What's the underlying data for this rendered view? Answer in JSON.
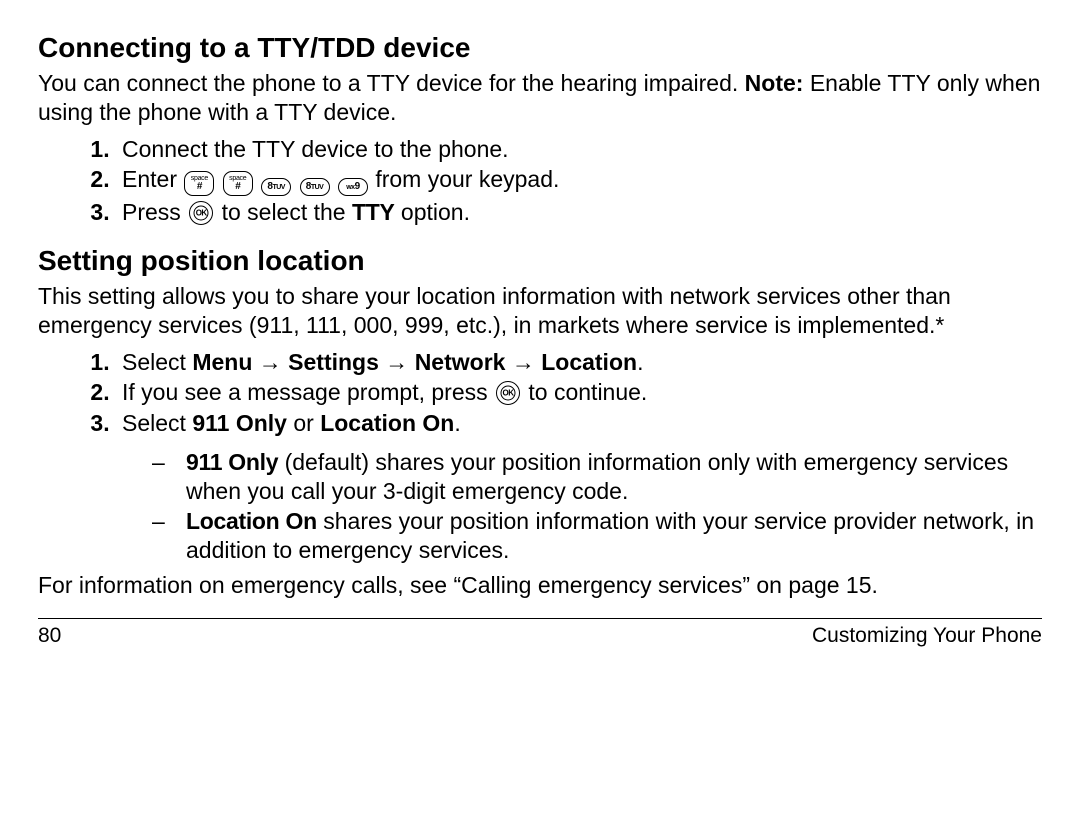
{
  "section1": {
    "heading": "Connecting to a TTY/TDD device",
    "intro_a": "You can connect the phone to a TTY device for the hearing impaired. ",
    "intro_note_label": "Note:",
    "intro_b": " Enable TTY only when using the phone with a TTY device.",
    "step1": "Connect the TTY device to the phone.",
    "step2_a": "Enter ",
    "step2_b": " from your keypad.",
    "step3_a": "Press ",
    "step3_b": " to select the ",
    "step3_opt": "TTY",
    "step3_c": " option."
  },
  "keys": {
    "hash_top": "space",
    "hash_bot": "#",
    "eight_top": "8",
    "eight_sub": "TUV",
    "nine_top": "wx",
    "nine_sub": "9"
  },
  "section2": {
    "heading": "Setting position location",
    "intro": "This setting allows you to share your location information with network services other than emergency services (911, 111, 000, 999, etc.), in markets where service is implemented.*",
    "step1_a": "Select ",
    "step1_menu": "Menu",
    "step1_settings": "Settings",
    "step1_network": "Network",
    "step1_location": "Location",
    "arrow": " → ",
    "step1_end": ".",
    "step2_a": "If you see a message prompt, press ",
    "step2_b": " to continue.",
    "step3_a": "Select ",
    "step3_opt1": "911 Only",
    "step3_or": " or ",
    "step3_opt2": "Location On",
    "step3_end": ".",
    "bullet1_label": "911 Only",
    "bullet1_text": " (default) shares your position information only with emergency services when you call your 3-digit emergency code.",
    "bullet2_label": "Location On",
    "bullet2_text": " shares your position information with your service provider network, in addition to emergency services.",
    "after": "For information on emergency calls, see “Calling emergency services” on page 15."
  },
  "footer": {
    "page": "80",
    "title": "Customizing Your Phone"
  }
}
